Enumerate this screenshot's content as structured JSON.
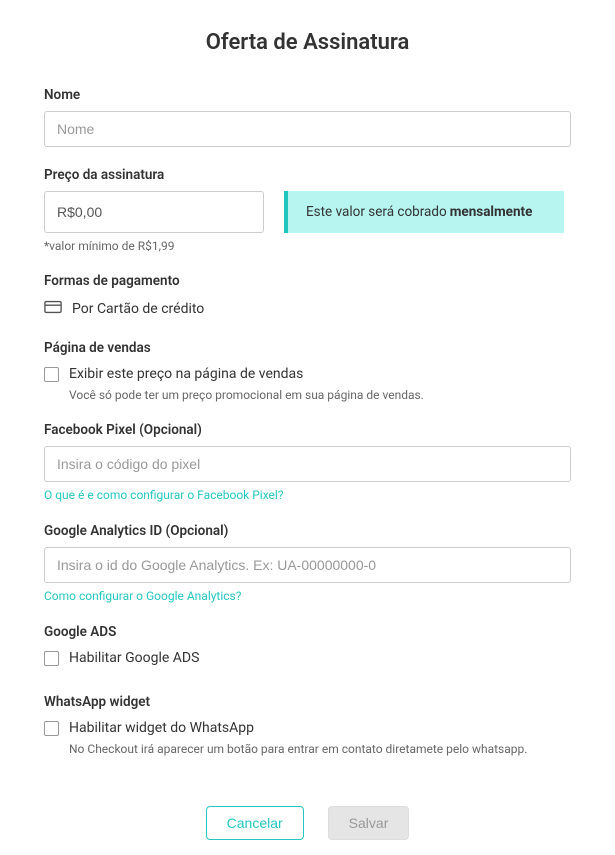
{
  "title": "Oferta de Assinatura",
  "nome": {
    "label": "Nome",
    "placeholder": "Nome",
    "value": ""
  },
  "preco": {
    "label": "Preço da assinatura",
    "value": "R$0,00",
    "helper": "*valor mínimo de R$1,99",
    "note_prefix": "Este valor será cobrado ",
    "note_bold": "mensalmente"
  },
  "pagamento": {
    "label": "Formas de pagamento",
    "method": "Por Cartão de crédito"
  },
  "pagina_vendas": {
    "label": "Página de vendas",
    "checkbox_label": "Exibir este preço na página de vendas",
    "helper": "Você só pode ter um preço promocional em sua página de vendas."
  },
  "facebook_pixel": {
    "label": "Facebook Pixel (Opcional)",
    "placeholder": "Insira o código do pixel",
    "link": "O que é e como configurar o Facebook Pixel?"
  },
  "google_analytics": {
    "label": "Google Analytics ID (Opcional)",
    "placeholder": "Insira o id do Google Analytics. Ex: UA-00000000-0",
    "link": "Como configurar o Google Analytics?"
  },
  "google_ads": {
    "label": "Google ADS",
    "checkbox_label": "Habilitar Google ADS"
  },
  "whatsapp": {
    "label": "WhatsApp widget",
    "checkbox_label": "Habilitar widget do WhatsApp",
    "helper": "No Checkout irá aparecer um botão para entrar em contato diretamete pelo whatsapp."
  },
  "buttons": {
    "cancel": "Cancelar",
    "save": "Salvar"
  }
}
